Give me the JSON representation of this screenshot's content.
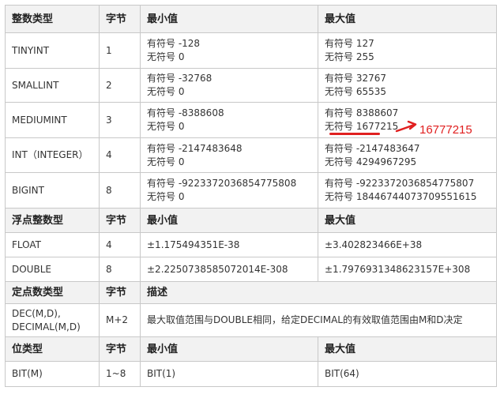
{
  "integer": {
    "header": {
      "type": "整数类型",
      "bytes": "字节",
      "min": "最小值",
      "max": "最大值"
    },
    "rows": [
      {
        "type": "TINYINT",
        "bytes": "1",
        "min1": "有符号 -128",
        "min2": "无符号 0",
        "max1": "有符号 127",
        "max2": "无符号 255"
      },
      {
        "type": "SMALLINT",
        "bytes": "2",
        "min1": "有符号 -32768",
        "min2": "无符号 0",
        "max1": "有符号 32767",
        "max2": "无符号 65535"
      },
      {
        "type": "MEDIUMINT",
        "bytes": "3",
        "min1": "有符号 -8388608",
        "min2": "无符号 0",
        "max1": "有符号 8388607",
        "max2": "无符号 1677215"
      },
      {
        "type": "INT（INTEGER）",
        "bytes": "4",
        "min1": "有符号 -2147483648",
        "min2": "无符号 0",
        "max1": "有符号 -2147483647",
        "max2": "无符号 4294967295"
      },
      {
        "type": "BIGINT",
        "bytes": "8",
        "min1": "有符号 -9223372036854775808",
        "min2": "无符号 0",
        "max1": "有符号 -9223372036854775807",
        "max2": "无符号 18446744073709551615"
      }
    ]
  },
  "float": {
    "header": {
      "type": "浮点整数型",
      "bytes": "字节",
      "min": "最小值",
      "max": "最大值"
    },
    "rows": [
      {
        "type": "FLOAT",
        "bytes": "4",
        "min": "±1.175494351E-38",
        "max": "±3.402823466E+38"
      },
      {
        "type": "DOUBLE",
        "bytes": "8",
        "min": "±2.2250738585072014E-308",
        "max": "±1.7976931348623157E+308"
      }
    ]
  },
  "fixed": {
    "header": {
      "type": "定点数类型",
      "bytes": "字节",
      "desc": "描述"
    },
    "row": {
      "type1": "DEC(M,D),",
      "type2": "DECIMAL(M,D)",
      "bytes": "M+2",
      "desc": "最大取值范围与DOUBLE相同，给定DECIMAL的有效取值范围由M和D决定"
    }
  },
  "bit": {
    "header": {
      "type": "位类型",
      "bytes": "字节",
      "min": "最小值",
      "max": "最大值"
    },
    "row": {
      "type": "BIT(M)",
      "bytes": "1~8",
      "min": "BIT(1)",
      "max": "BIT(64)"
    }
  },
  "annotation": {
    "text": "16777215",
    "color": "#e02020"
  }
}
